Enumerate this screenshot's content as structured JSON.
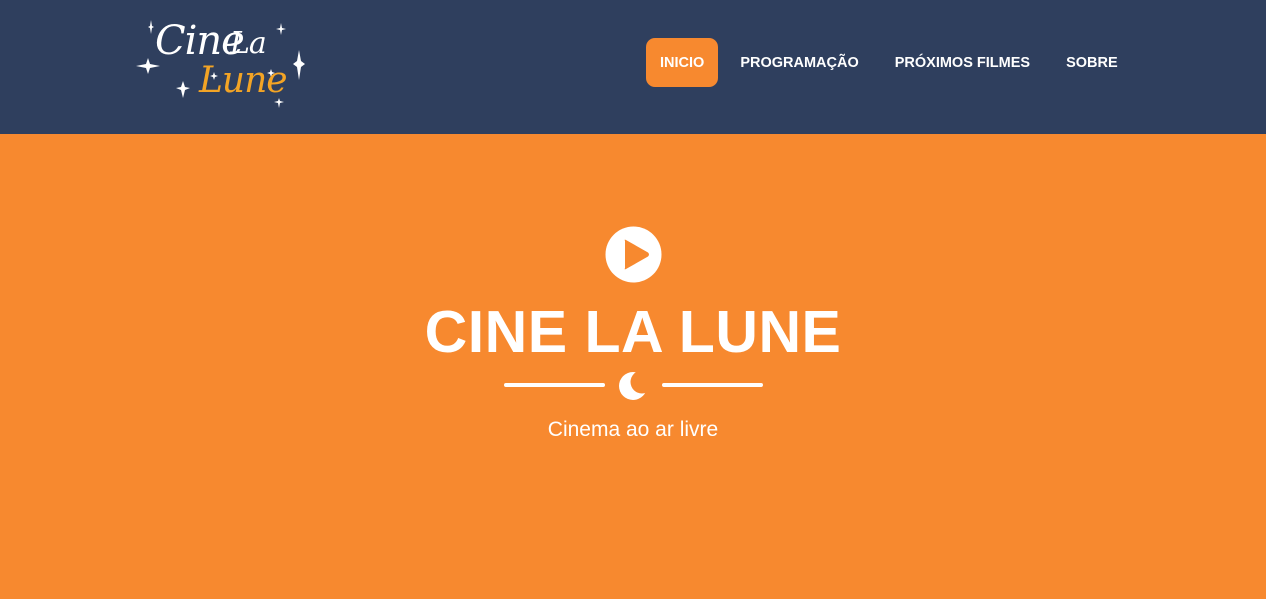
{
  "brand": {
    "logo_line1": "Cine",
    "logo_line2": "La",
    "logo_line3": "Lune",
    "logo_accent_color": "#f3a425"
  },
  "nav": {
    "items": [
      {
        "label": "INICIO",
        "active": true
      },
      {
        "label": "PROGRAMAÇÃO",
        "active": false
      },
      {
        "label": "PRÓXIMOS FILMES",
        "active": false
      },
      {
        "label": "SOBRE",
        "active": false
      }
    ]
  },
  "hero": {
    "icon": "play-circle-icon",
    "title": "CINE LA LUNE",
    "divider_icon": "moon-icon",
    "subtitle": "Cinema ao ar livre"
  },
  "colors": {
    "navbar_bg": "#2f3f5e",
    "accent": "#f7892f",
    "text": "#ffffff"
  }
}
